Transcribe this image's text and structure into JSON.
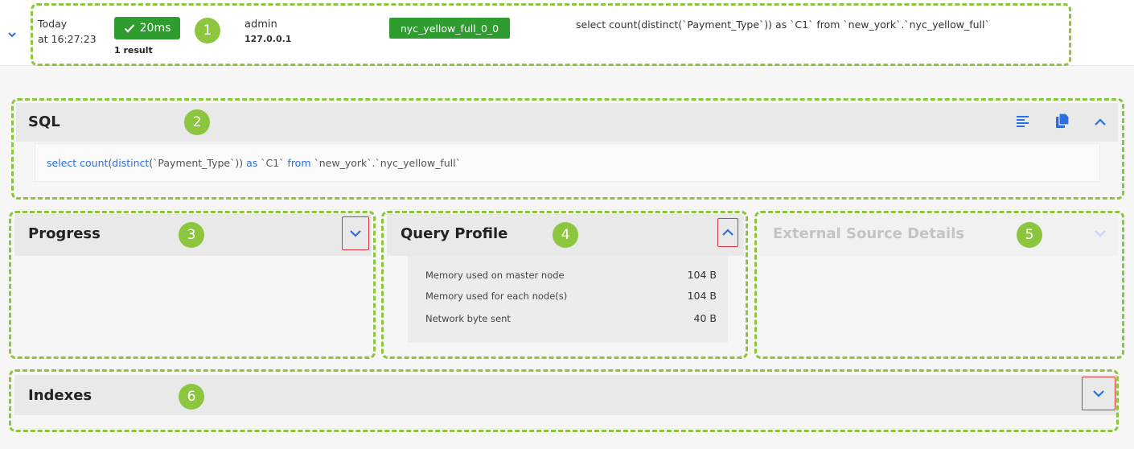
{
  "query_row": {
    "date_day": "Today",
    "date_time": "at 16:27:23",
    "duration": "20ms",
    "results": "1 result",
    "user": "admin",
    "ip": "127.0.0.1",
    "table": "nyc_yellow_full_0_0",
    "sql_preview": "select count(distinct(`Payment_Type`)) as `C1` from `new_york`.`nyc_yellow_full`"
  },
  "sql_panel": {
    "title": "SQL",
    "sql_parts": [
      {
        "text": "select ",
        "kw": true
      },
      {
        "text": "count",
        "kw": true
      },
      {
        "text": "(",
        "kw": false
      },
      {
        "text": "distinct",
        "kw": true
      },
      {
        "text": "(`Payment_Type`)) ",
        "kw": false
      },
      {
        "text": "as",
        "kw": true
      },
      {
        "text": " `C1` ",
        "kw": false
      },
      {
        "text": "from",
        "kw": true
      },
      {
        "text": " `new_york`.`nyc_yellow_full`",
        "kw": false
      }
    ]
  },
  "progress_panel": {
    "title": "Progress"
  },
  "query_profile_panel": {
    "title": "Query Profile",
    "metrics": [
      {
        "label": "Memory used on master node",
        "value": "104 B"
      },
      {
        "label": "Memory used for each node(s)",
        "value": "104 B"
      },
      {
        "label": "Network byte sent",
        "value": "40 B"
      }
    ]
  },
  "external_source_panel": {
    "title": "External Source Details"
  },
  "indexes_panel": {
    "title": "Indexes"
  },
  "annotations": [
    "1",
    "2",
    "3",
    "4",
    "5",
    "6"
  ],
  "colors": {
    "success_green": "#2e9c2e",
    "annotation_green": "#8cc63f",
    "link_blue": "#2b6fe0",
    "highlight_red": "#d9363e"
  },
  "icons": {
    "row_toggle": "chevron-down-icon",
    "success": "check-icon",
    "format": "format-align-left-icon",
    "copy": "copy-icon",
    "collapse": "chevron-up-icon",
    "expand": "chevron-down-icon"
  }
}
